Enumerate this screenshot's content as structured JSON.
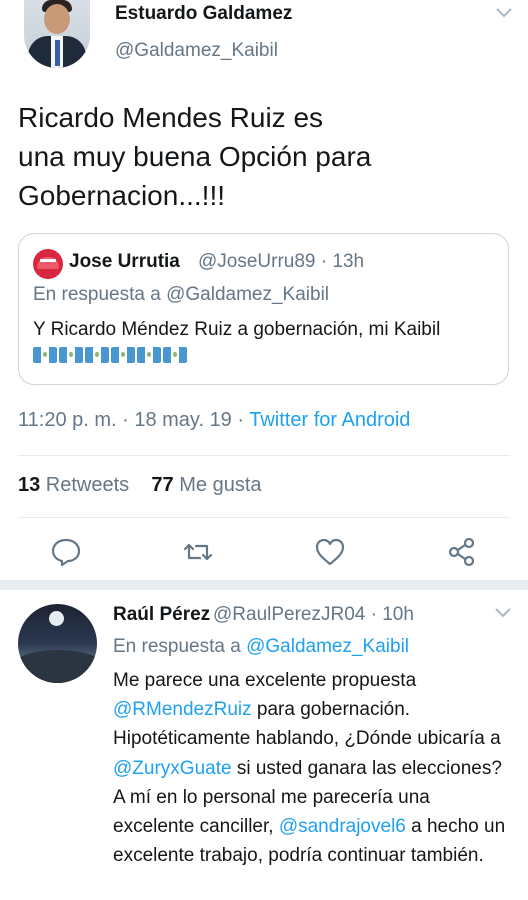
{
  "main_tweet": {
    "author_name": "Estuardo Galdamez",
    "author_handle": "@Galdamez_Kaibil",
    "text_lines": [
      "Ricardo Mendes Ruiz es",
      "una muy buena Opción para",
      "Gobernacion...!!!"
    ],
    "timestamp": "11:20 p. m. · 18 may. 19 · ",
    "source": "Twitter for Android",
    "retweets_count": "13",
    "retweets_label": " Retweets",
    "likes_count": "77",
    "likes_label": " Me gusta"
  },
  "quoted_tweet": {
    "author_name": "Jose Urrutia",
    "author_handle": "@JoseUrru89 · 13h",
    "reply_prefix": "En respuesta a ",
    "reply_to": "@Galdamez_Kaibil",
    "text": "Y Ricardo Méndez Ruiz a gobernación, mi Kaibil",
    "flag_emoji_count": 6
  },
  "reply_tweet": {
    "author_name": "Raúl Pérez",
    "author_handle": "@RaulPerezJR04 · 10h",
    "reply_prefix": "En respuesta a ",
    "reply_to": "@Galdamez_Kaibil",
    "text_parts": {
      "p1": "Me parece una excelente propuesta ",
      "m1": "@RMendezRuiz",
      "p2": " para gobernación. Hipotéticamente hablando, ¿Dónde ubicaría a ",
      "m2": "@ZuryxGuate",
      "p3": " si usted ganara las elecciones? A mí en lo personal me parecería una excelente canciller, ",
      "m3": "@sandrajovel6",
      "p4": " a hecho un excelente trabajo, podría continuar también."
    }
  },
  "actions": [
    "reply-icon",
    "retweet-icon",
    "like-icon",
    "share-icon"
  ],
  "colors": {
    "link": "#1da1f2",
    "secondary_text": "#657786",
    "divider": "#e6ecf0"
  }
}
